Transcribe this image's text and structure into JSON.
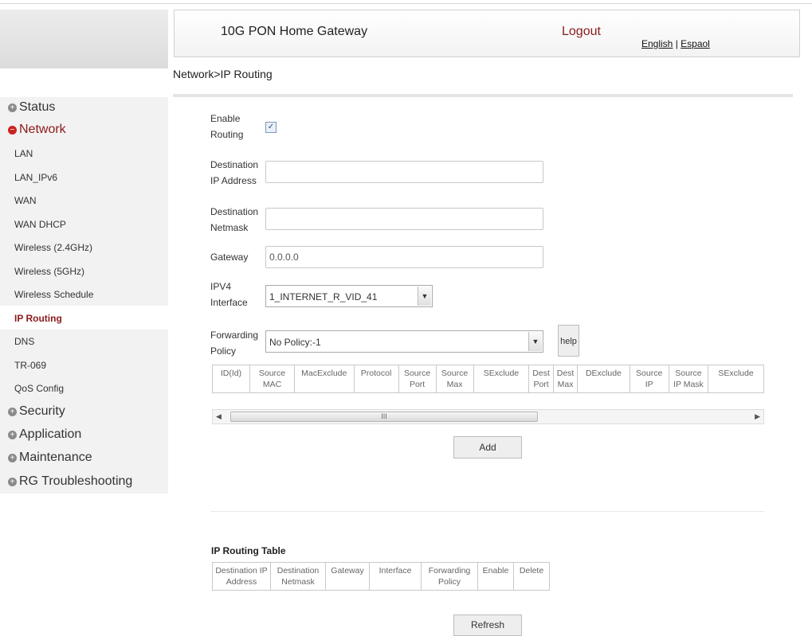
{
  "header": {
    "title": "10G PON Home Gateway",
    "logout": "Logout",
    "lang_english": "English",
    "lang_sep": " | ",
    "lang_espanol": "Espaol"
  },
  "breadcrumb": "Network>IP Routing",
  "sidebar": {
    "status": "Status",
    "network": "Network",
    "network_items": [
      "LAN",
      "LAN_IPv6",
      "WAN",
      "WAN DHCP",
      "Wireless (2.4GHz)",
      "Wireless (5GHz)",
      "Wireless Schedule",
      "IP Routing",
      "DNS",
      "TR-069",
      "QoS Config"
    ],
    "active_item": "IP Routing",
    "security": "Security",
    "application": "Application",
    "maintenance": "Maintenance",
    "rg_troubleshooting": "RG Troubleshooting"
  },
  "form": {
    "enable_routing_label_1": "Enable",
    "enable_routing_label_2": "Routing",
    "enable_routing_checked": true,
    "dest_ip_label_1": "Destination",
    "dest_ip_label_2": "IP Address",
    "dest_ip_value": "",
    "dest_mask_label_1": "Destination",
    "dest_mask_label_2": "Netmask",
    "dest_mask_value": "",
    "gateway_label": "Gateway",
    "gateway_value": "0.0.0.0",
    "ipv4_label_1": "IPV4",
    "ipv4_label_2": "Interface",
    "ipv4_value": "1_INTERNET_R_VID_41",
    "fwd_label_1": "Forwarding",
    "fwd_label_2": "Policy",
    "fwd_value": "No Policy:-1",
    "help": "help",
    "add": "Add"
  },
  "policy_table": {
    "headers": [
      "ID(Id)",
      "Source MAC",
      "MacExclude",
      "Protocol",
      "Source Port",
      "Source Max",
      "SExclude",
      "Dest Port",
      "Dest Max",
      "DExclude",
      "Source IP",
      "Source IP Mask",
      "SExclude"
    ],
    "scroll_glyph": "III"
  },
  "routing_table": {
    "title": "IP Routing Table",
    "headers": [
      "Destination IP Address",
      "Destination Netmask",
      "Gateway",
      "Interface",
      "Forwarding Policy",
      "Enable",
      "Delete"
    ],
    "refresh": "Refresh"
  }
}
